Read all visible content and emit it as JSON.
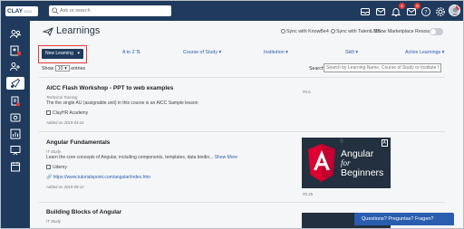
{
  "topbar": {
    "logo": "CLAY",
    "logo_suffix": "EDU",
    "search_placeholder": "Ask or search",
    "badges": {
      "notifications": "1",
      "messages": "5",
      "avatar": "3"
    }
  },
  "header": {
    "title": "Learnings",
    "sync_knowbe4": "Sync with KnowBe4",
    "sync_talentlms": "Sync with TalentLMS",
    "show_marketplace": "Show Marketplace Resources"
  },
  "toolbar": {
    "new_learning_label": "New Learning",
    "filters": [
      "A to Z",
      "Course of Study",
      "Institution",
      "Skill",
      "Active Learnings"
    ]
  },
  "table": {
    "show_label": "Show",
    "entries_value": "10",
    "entries_label": "entries",
    "search_label": "Search:",
    "search_placeholder": "Search by Learning Name, Course of Study or Institute Name"
  },
  "items": [
    {
      "title": "AICC Flash Workshop - PPT to web examples",
      "type": "Technical Training",
      "description": "The the single AU (assignable unit) in this course is an AICC Sample lesson",
      "provider": "ClayHR Academy",
      "date": "Added on 2019-04-24",
      "number": "#0.5"
    },
    {
      "title": "Angular Fundamentals",
      "type": "IT Study",
      "description": "Learn the core concepts of Angular, including components, templates, data bindin...",
      "more": "Show More",
      "provider": "Udemy",
      "link": "https://www.tutorialspoint.com/angular/index.htm",
      "date": "Added on 2019-08-12",
      "number": "#0.25",
      "thumbnail": {
        "line1": "Angular",
        "line2": "for",
        "line3": "Beginners",
        "badge": "A"
      }
    },
    {
      "title": "Building Blocks of Angular",
      "type": "IT Study",
      "thumbnail_badge": "A"
    }
  ],
  "chat_label": "Questions? Preguntas? Fragen?"
}
